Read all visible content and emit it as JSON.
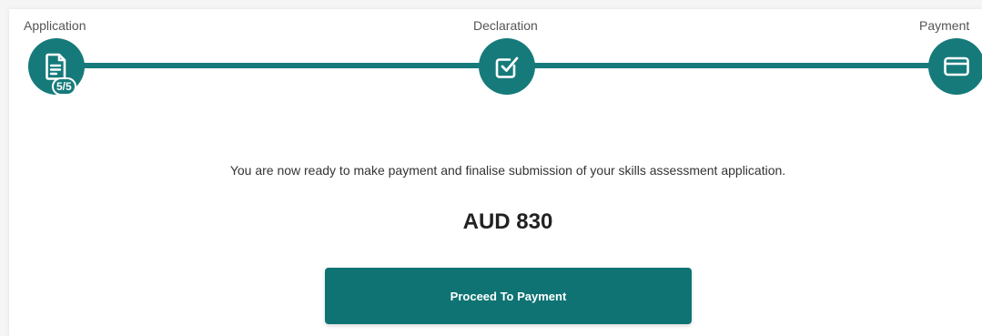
{
  "stepper": {
    "steps": [
      {
        "label": "Application",
        "icon": "document-icon",
        "badge": "5/5"
      },
      {
        "label": "Declaration",
        "icon": "checkbox-icon"
      },
      {
        "label": "Payment",
        "icon": "credit-card-icon"
      }
    ],
    "color": "#167a7a"
  },
  "main": {
    "message": "You are now ready to make payment and finalise submission of your skills assessment application.",
    "amount": "AUD 830",
    "button_label": "Proceed To Payment",
    "button_color": "#0f7373"
  }
}
